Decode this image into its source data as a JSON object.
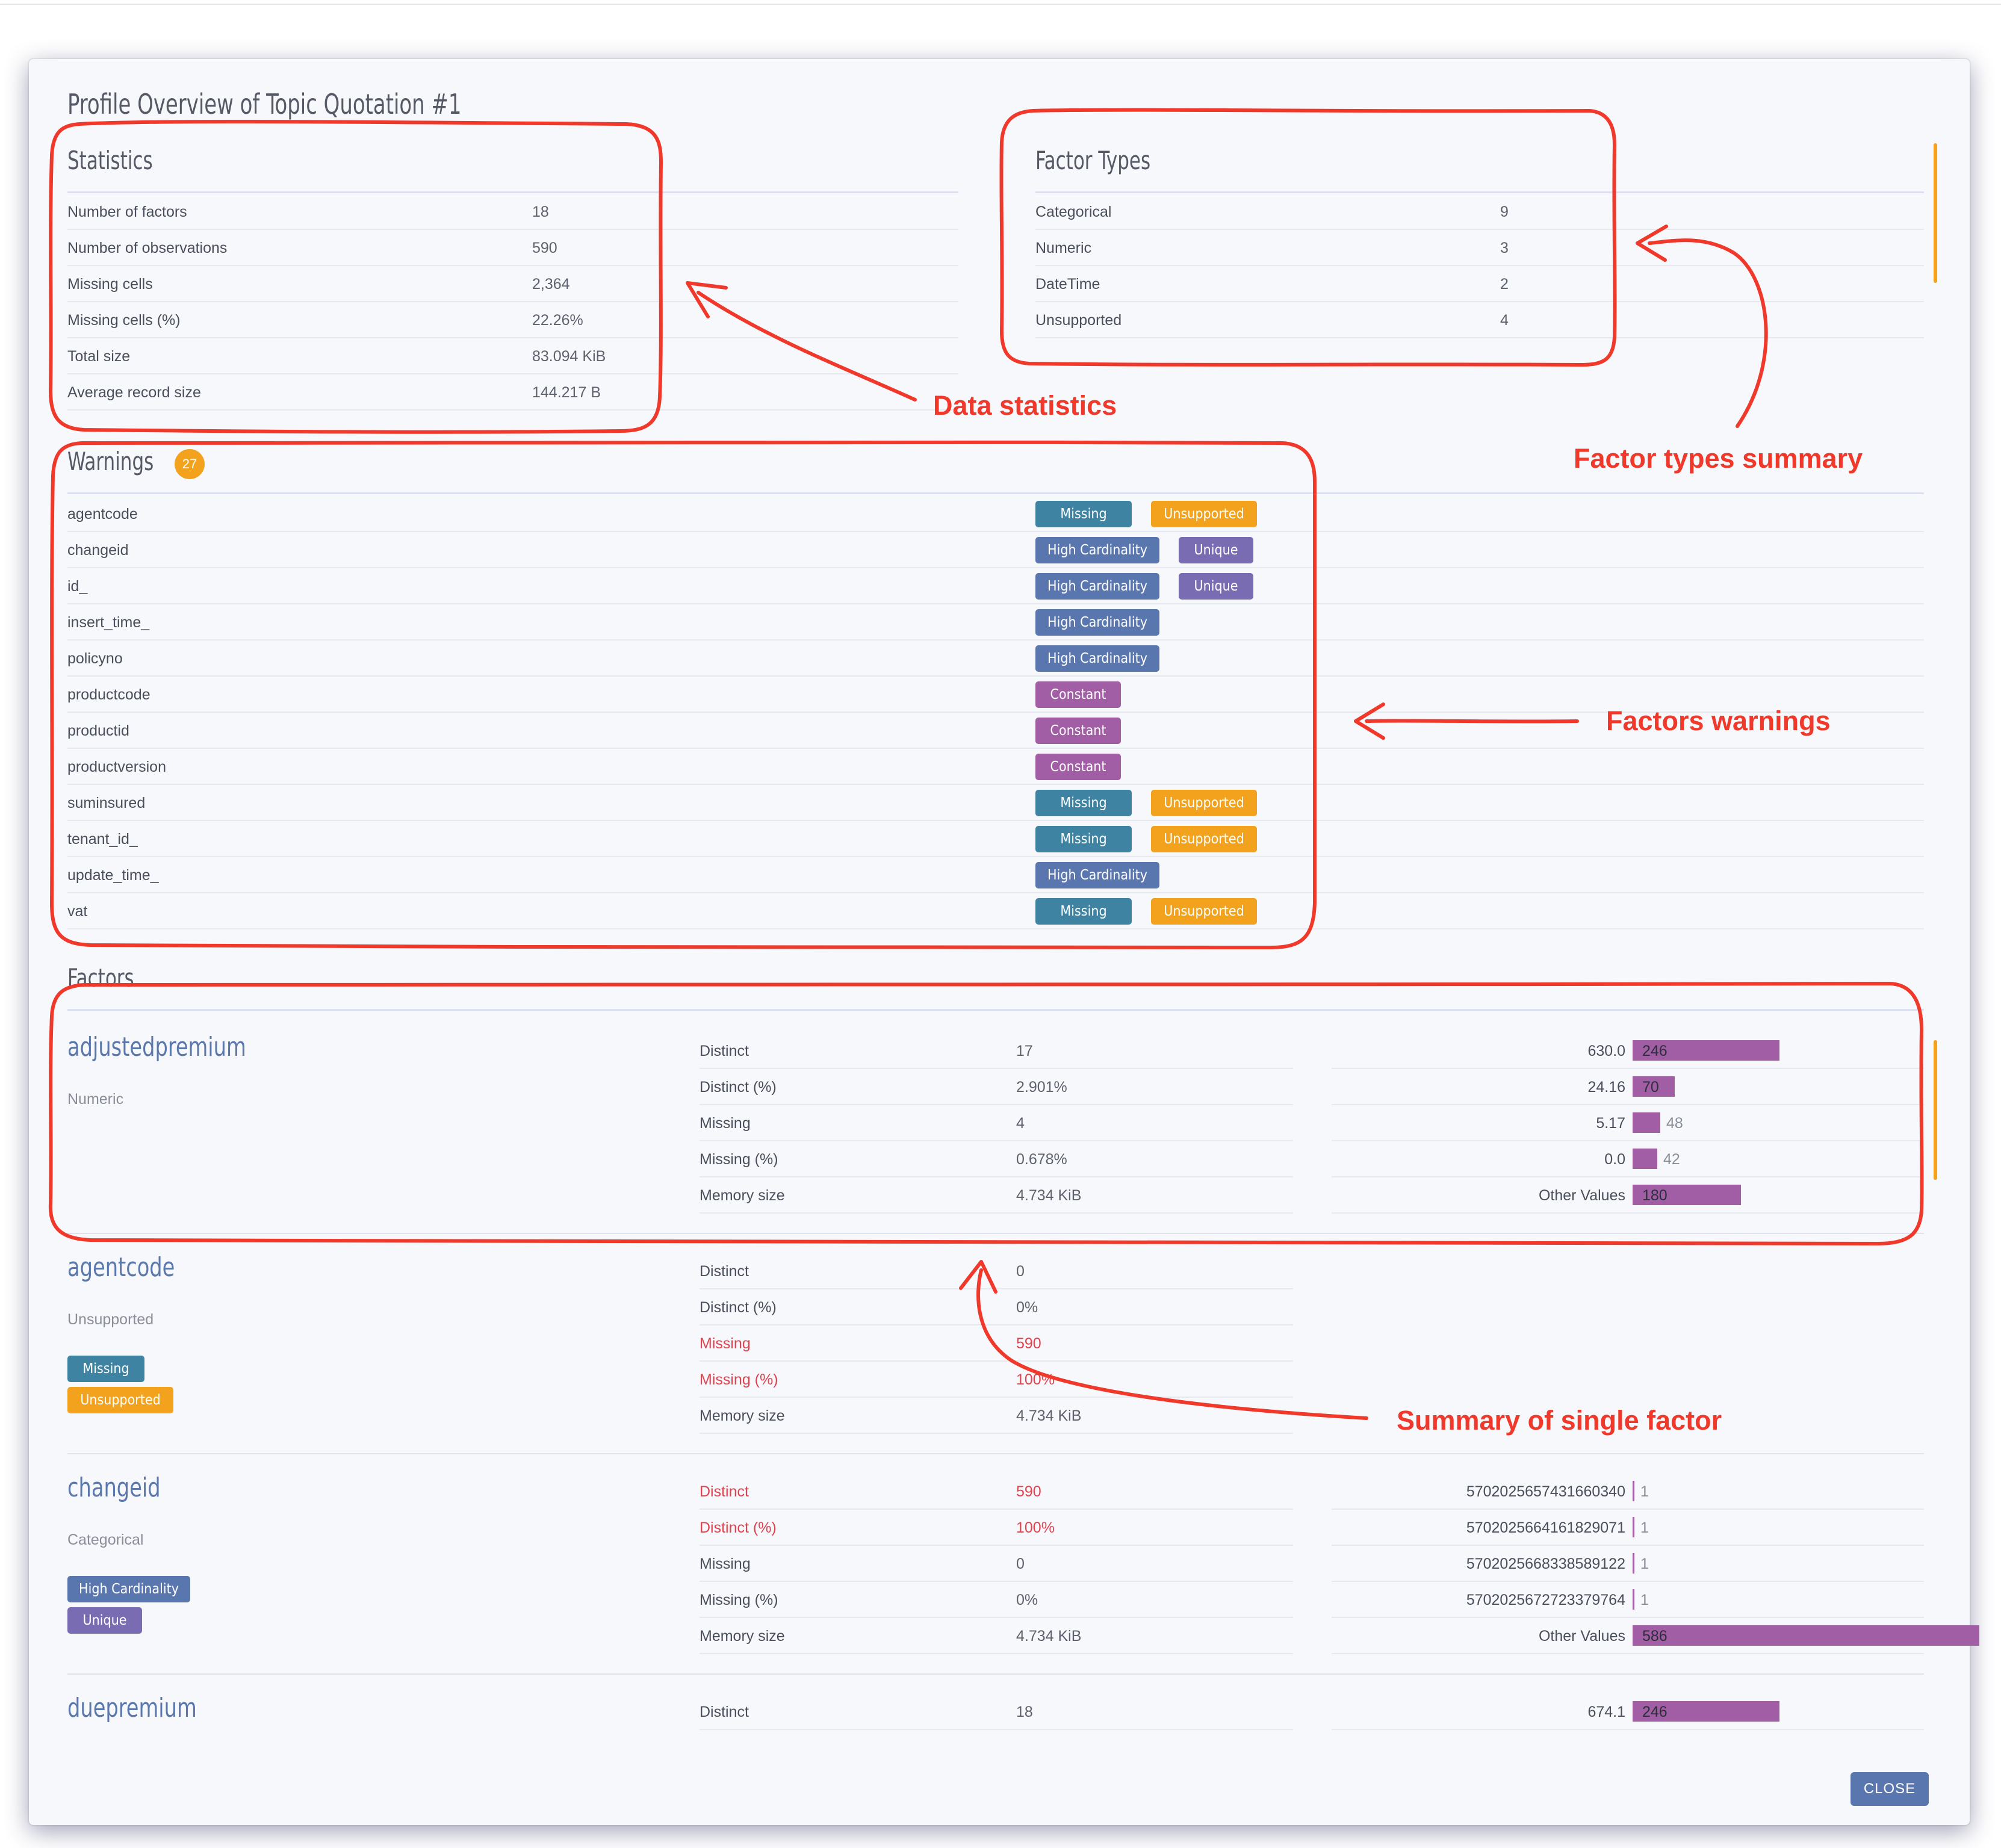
{
  "dialog": {
    "title": "Profile Overview of Topic Quotation #1",
    "close_label": "CLOSE"
  },
  "statistics": {
    "heading": "Statistics",
    "rows": [
      {
        "label": "Number of factors",
        "value": "18"
      },
      {
        "label": "Number of observations",
        "value": "590"
      },
      {
        "label": "Missing cells",
        "value": "2,364"
      },
      {
        "label": "Missing cells (%)",
        "value": "22.26%"
      },
      {
        "label": "Total size",
        "value": "83.094 KiB"
      },
      {
        "label": "Average record size",
        "value": "144.217 B"
      }
    ]
  },
  "factor_types": {
    "heading": "Factor Types",
    "rows": [
      {
        "label": "Categorical",
        "value": "9"
      },
      {
        "label": "Numeric",
        "value": "3"
      },
      {
        "label": "DateTime",
        "value": "2"
      },
      {
        "label": "Unsupported",
        "value": "4"
      }
    ]
  },
  "warnings": {
    "heading": "Warnings",
    "count": "27",
    "rows": [
      {
        "name": "agentcode",
        "badges": [
          "Missing",
          "Unsupported"
        ]
      },
      {
        "name": "changeid",
        "badges": [
          "High Cardinality",
          "Unique"
        ]
      },
      {
        "name": "id_",
        "badges": [
          "High Cardinality",
          "Unique"
        ]
      },
      {
        "name": "insert_time_",
        "badges": [
          "High Cardinality"
        ]
      },
      {
        "name": "policyno",
        "badges": [
          "High Cardinality"
        ]
      },
      {
        "name": "productcode",
        "badges": [
          "Constant"
        ]
      },
      {
        "name": "productid",
        "badges": [
          "Constant"
        ]
      },
      {
        "name": "productversion",
        "badges": [
          "Constant"
        ]
      },
      {
        "name": "suminsured",
        "badges": [
          "Missing",
          "Unsupported"
        ]
      },
      {
        "name": "tenant_id_",
        "badges": [
          "Missing",
          "Unsupported"
        ]
      },
      {
        "name": "update_time_",
        "badges": [
          "High Cardinality"
        ]
      },
      {
        "name": "vat",
        "badges": [
          "Missing",
          "Unsupported"
        ]
      }
    ]
  },
  "factors": {
    "heading": "Factors",
    "items": [
      {
        "name": "adjustedpremium",
        "type": "Numeric",
        "badges": [],
        "stats": [
          {
            "label": "Distinct",
            "value": "17"
          },
          {
            "label": "Distinct (%)",
            "value": "2.901%"
          },
          {
            "label": "Missing",
            "value": "4"
          },
          {
            "label": "Missing (%)",
            "value": "0.678%"
          },
          {
            "label": "Memory size",
            "value": "4.734 KiB"
          }
        ],
        "freq": [
          {
            "key": "630.0",
            "count": "246",
            "share": 0.42
          },
          {
            "key": "24.16",
            "count": "70",
            "share": 0.12
          },
          {
            "key": "5.17",
            "count": "48",
            "share": 0.08
          },
          {
            "key": "0.0",
            "count": "42",
            "share": 0.07
          },
          {
            "key": "Other Values",
            "count": "180",
            "share": 0.31
          }
        ]
      },
      {
        "name": "agentcode",
        "type": "Unsupported",
        "badges": [
          "Missing",
          "Unsupported"
        ],
        "stats": [
          {
            "label": "Distinct",
            "value": "0"
          },
          {
            "label": "Distinct (%)",
            "value": "0%"
          },
          {
            "label": "Missing",
            "value": "590",
            "alert": true
          },
          {
            "label": "Missing (%)",
            "value": "100%",
            "alert": true
          },
          {
            "label": "Memory size",
            "value": "4.734 KiB"
          }
        ],
        "freq": []
      },
      {
        "name": "changeid",
        "type": "Categorical",
        "badges": [
          "High Cardinality",
          "Unique"
        ],
        "stats": [
          {
            "label": "Distinct",
            "value": "590",
            "alert": true
          },
          {
            "label": "Distinct (%)",
            "value": "100%",
            "alert": true
          },
          {
            "label": "Missing",
            "value": "0"
          },
          {
            "label": "Missing (%)",
            "value": "0%"
          },
          {
            "label": "Memory size",
            "value": "4.734 KiB"
          }
        ],
        "freq": [
          {
            "key": "5702025657431660340",
            "count": "1",
            "share": 0.0017
          },
          {
            "key": "5702025664161829071",
            "count": "1",
            "share": 0.0017
          },
          {
            "key": "5702025668338589122",
            "count": "1",
            "share": 0.0017
          },
          {
            "key": "5702025672723379764",
            "count": "1",
            "share": 0.0017
          },
          {
            "key": "Other Values",
            "count": "586",
            "share": 0.993
          }
        ]
      },
      {
        "name": "duepremium",
        "type": "",
        "badges": [],
        "stats": [
          {
            "label": "Distinct",
            "value": "18"
          }
        ],
        "freq": [
          {
            "key": "674.1",
            "count": "246",
            "share": 0.42
          }
        ]
      }
    ]
  },
  "annotations": {
    "data_statistics": "Data statistics",
    "factor_types_summary": "Factor types summary",
    "factors_warnings": "Factors warnings",
    "summary_single_factor": "Summary of single factor"
  },
  "colors": {
    "missing": "#3f83a3",
    "unsupported": "#f3a21d",
    "high_cardinality": "#5a76ae",
    "unique": "#7a6cb3",
    "constant": "#a15ea4",
    "bar": "#a15ea4",
    "alert_text": "#e0434f",
    "annotation": "#f0382b"
  }
}
